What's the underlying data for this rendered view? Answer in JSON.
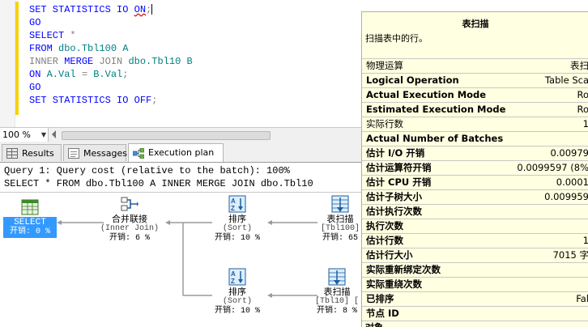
{
  "editor": {
    "lines": [
      {
        "segs": [
          {
            "t": "SET STATISTICS IO ",
            "c": "kw"
          },
          {
            "t": "ON",
            "c": "kw sq"
          },
          {
            "t": ";",
            "c": "gr"
          }
        ]
      },
      {
        "segs": [
          {
            "t": "GO",
            "c": "kw"
          }
        ]
      },
      {
        "segs": [
          {
            "t": "SELECT ",
            "c": "kw"
          },
          {
            "t": "*",
            "c": "gr"
          }
        ]
      },
      {
        "segs": [
          {
            "t": "FROM ",
            "c": "kw"
          },
          {
            "t": "dbo.Tbl100 A",
            "c": "tx"
          }
        ]
      },
      {
        "segs": [
          {
            "t": "INNER ",
            "c": "gr"
          },
          {
            "t": "MERGE ",
            "c": "kw"
          },
          {
            "t": "JOIN ",
            "c": "gr"
          },
          {
            "t": "dbo.Tbl10 B",
            "c": "tx"
          }
        ]
      },
      {
        "segs": [
          {
            "t": "ON ",
            "c": "kw"
          },
          {
            "t": "A.Val ",
            "c": "tx"
          },
          {
            "t": "= ",
            "c": "gr"
          },
          {
            "t": "B.Val",
            "c": "tx"
          },
          {
            "t": ";",
            "c": "gr"
          }
        ]
      },
      {
        "segs": [
          {
            "t": "GO",
            "c": "kw"
          }
        ]
      },
      {
        "segs": [
          {
            "t": "SET STATISTICS IO ",
            "c": "kw"
          },
          {
            "t": "OFF",
            "c": "kw"
          },
          {
            "t": ";",
            "c": "gr"
          }
        ]
      }
    ]
  },
  "zoom": {
    "value": "100 %"
  },
  "tabs": [
    {
      "label": "Results",
      "icon": "grid-icon",
      "active": false
    },
    {
      "label": "Messages",
      "icon": "message-icon",
      "active": false
    },
    {
      "label": "Execution plan",
      "icon": "execution-plan-icon",
      "active": true
    }
  ],
  "plan": {
    "query_header": "Query 1: Query cost (relative to the batch): 100%",
    "query_text": "SELECT * FROM dbo.Tbl100 A INNER MERGE JOIN dbo.Tbl10",
    "nodes": {
      "select": {
        "label": "SELECT",
        "cost": "开销: 0 %"
      },
      "merge": {
        "label": "合并联接",
        "sub": "(Inner Join)",
        "cost": "开销: 6 %"
      },
      "sort_top": {
        "label": "排序",
        "sub": "(Sort)",
        "cost": "开销: 10 %"
      },
      "scan_top": {
        "label": "表扫描",
        "sub": "[Tbl100]",
        "cost": "开销: 65"
      },
      "sort_bottom": {
        "label": "排序",
        "sub": "(Sort)",
        "cost": "开销: 10 %"
      },
      "scan_bottom": {
        "label": "表扫描",
        "sub": "[Tbl10] [",
        "cost": "开销: 8 %"
      }
    }
  },
  "tooltip": {
    "title": "表扫描",
    "description": "扫描表中的行。",
    "rows": [
      {
        "k": "物理运算",
        "v": "表扫",
        "bold": false
      },
      {
        "k": "Logical Operation",
        "v": "Table Sca",
        "bold": true
      },
      {
        "k": "Actual Execution Mode",
        "v": "Ro",
        "bold": true
      },
      {
        "k": "Estimated Execution Mode",
        "v": "Ro",
        "bold": true
      },
      {
        "k": "实际行数",
        "v": "1",
        "bold": false
      },
      {
        "k": "Actual Number of Batches",
        "v": "",
        "bold": true
      },
      {
        "k": "估计 I/O 开销",
        "v": "0.00979",
        "bold": true
      },
      {
        "k": "估计运算符开销",
        "v": "0.0099597 (8%",
        "bold": true
      },
      {
        "k": "估计 CPU 开销",
        "v": "0.0001",
        "bold": true
      },
      {
        "k": "估计子树大小",
        "v": "0.009959",
        "bold": true
      },
      {
        "k": "估计执行次数",
        "v": "",
        "bold": true
      },
      {
        "k": "执行次数",
        "v": "",
        "bold": true
      },
      {
        "k": "估计行数",
        "v": "1",
        "bold": true
      },
      {
        "k": "估计行大小",
        "v": "7015 字",
        "bold": true
      },
      {
        "k": "实际重新绑定次数",
        "v": "",
        "bold": true
      },
      {
        "k": "实际重绕次数",
        "v": "",
        "bold": true
      },
      {
        "k": "已排序",
        "v": "Fal",
        "bold": true
      },
      {
        "k": "节点 ID",
        "v": "",
        "bold": true
      }
    ],
    "object_label": "对象"
  },
  "colors": {
    "select_highlight": "#3399ff",
    "keyword": "#0000ff",
    "identifier": "#008080",
    "tooltip_bg": "#ffffe1"
  }
}
